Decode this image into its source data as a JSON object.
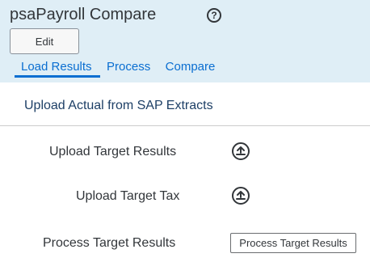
{
  "header": {
    "title": "psaPayroll Compare",
    "help_icon": "question-circle-icon",
    "help_glyph": "?",
    "edit_label": "Edit"
  },
  "tabs": [
    {
      "label": "Load Results",
      "active": true
    },
    {
      "label": "Process",
      "active": false
    },
    {
      "label": "Compare",
      "active": false
    }
  ],
  "main": {
    "section_title": "Upload Actual from SAP Extracts",
    "rows": [
      {
        "label": "Upload Target Results",
        "action_icon": "upload-icon"
      },
      {
        "label": "Upload Target Tax",
        "action_icon": "upload-icon"
      },
      {
        "label": "Process Target Results",
        "button_label": "Process Target Results"
      }
    ]
  },
  "colors": {
    "header_bg": "#dfeef6",
    "link": "#0a6ed1",
    "section_title": "#1d3f66"
  }
}
